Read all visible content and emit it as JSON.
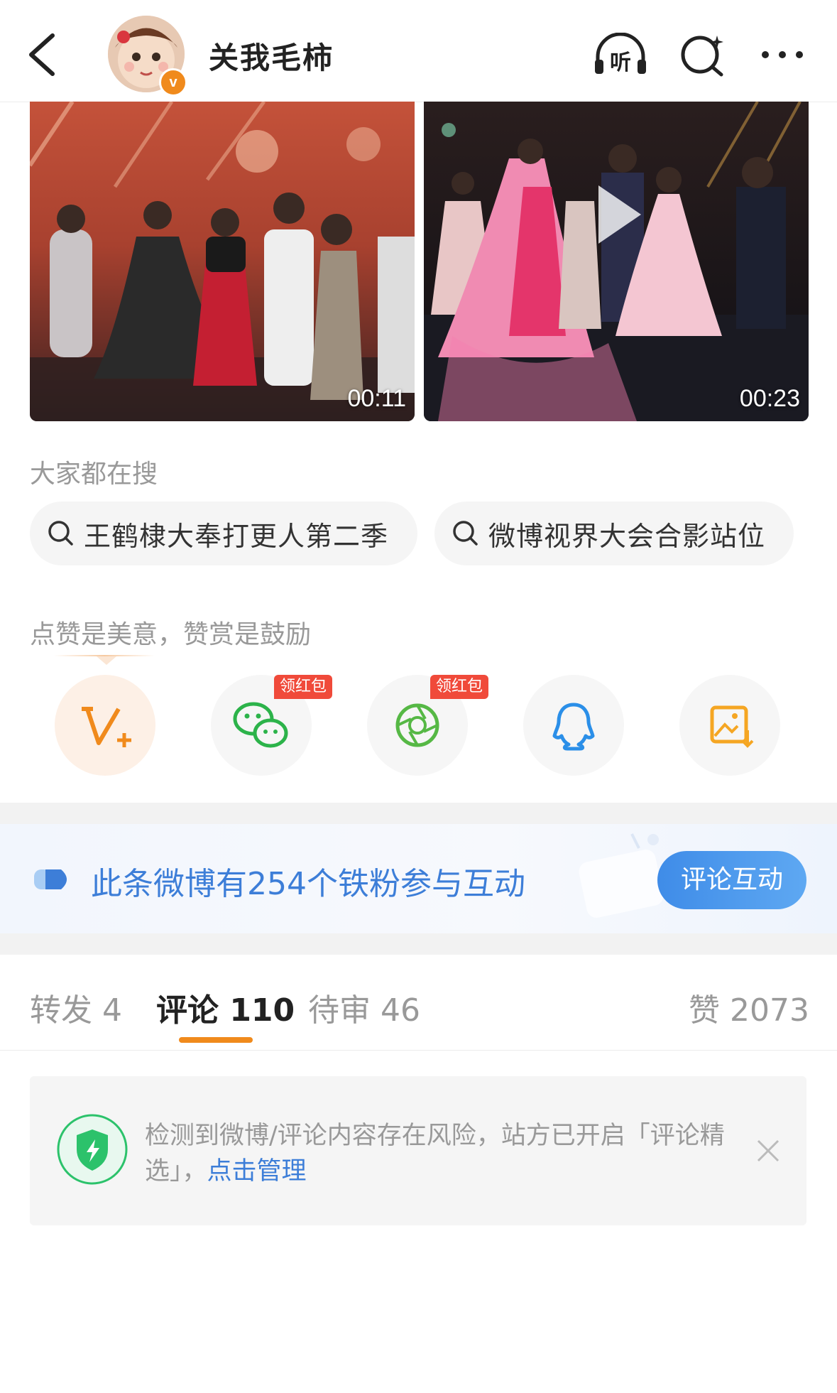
{
  "header": {
    "username": "关我毛柿",
    "icons": [
      "back-icon",
      "listen-icon",
      "search-icon",
      "more-icon"
    ],
    "listen_label": "听"
  },
  "videos": [
    {
      "duration": "00:11"
    },
    {
      "duration": "00:23"
    }
  ],
  "search_section": {
    "label": "大家都在搜",
    "chips": [
      "王鹤棣大奉打更人第二季",
      "微博视界大会合影站位"
    ]
  },
  "reward_section": {
    "label": "点赞是美意，赞赏是鼓励",
    "buttons": [
      {
        "icon": "reward-v-icon",
        "tag": ""
      },
      {
        "icon": "wechat-icon",
        "tag": "领红包"
      },
      {
        "icon": "moments-icon",
        "tag": "领红包"
      },
      {
        "icon": "qq-icon",
        "tag": ""
      },
      {
        "icon": "save-image-icon",
        "tag": ""
      }
    ]
  },
  "fan_banner": {
    "text": "此条微博有254个铁粉参与互动",
    "button": "评论互动"
  },
  "tabs": {
    "repost": "转发 4",
    "comments": "评论 110",
    "pending": "待审 46",
    "likes": "赞 2073"
  },
  "notice": {
    "text": "检测到微博/评论内容存在风险，站方已开启「评论精选」，",
    "link": "点击管理"
  },
  "colors": {
    "accent": "#f08a1c",
    "link": "#3d7ed8",
    "red_tag": "#f04a3a",
    "shield": "#2cc26b"
  }
}
